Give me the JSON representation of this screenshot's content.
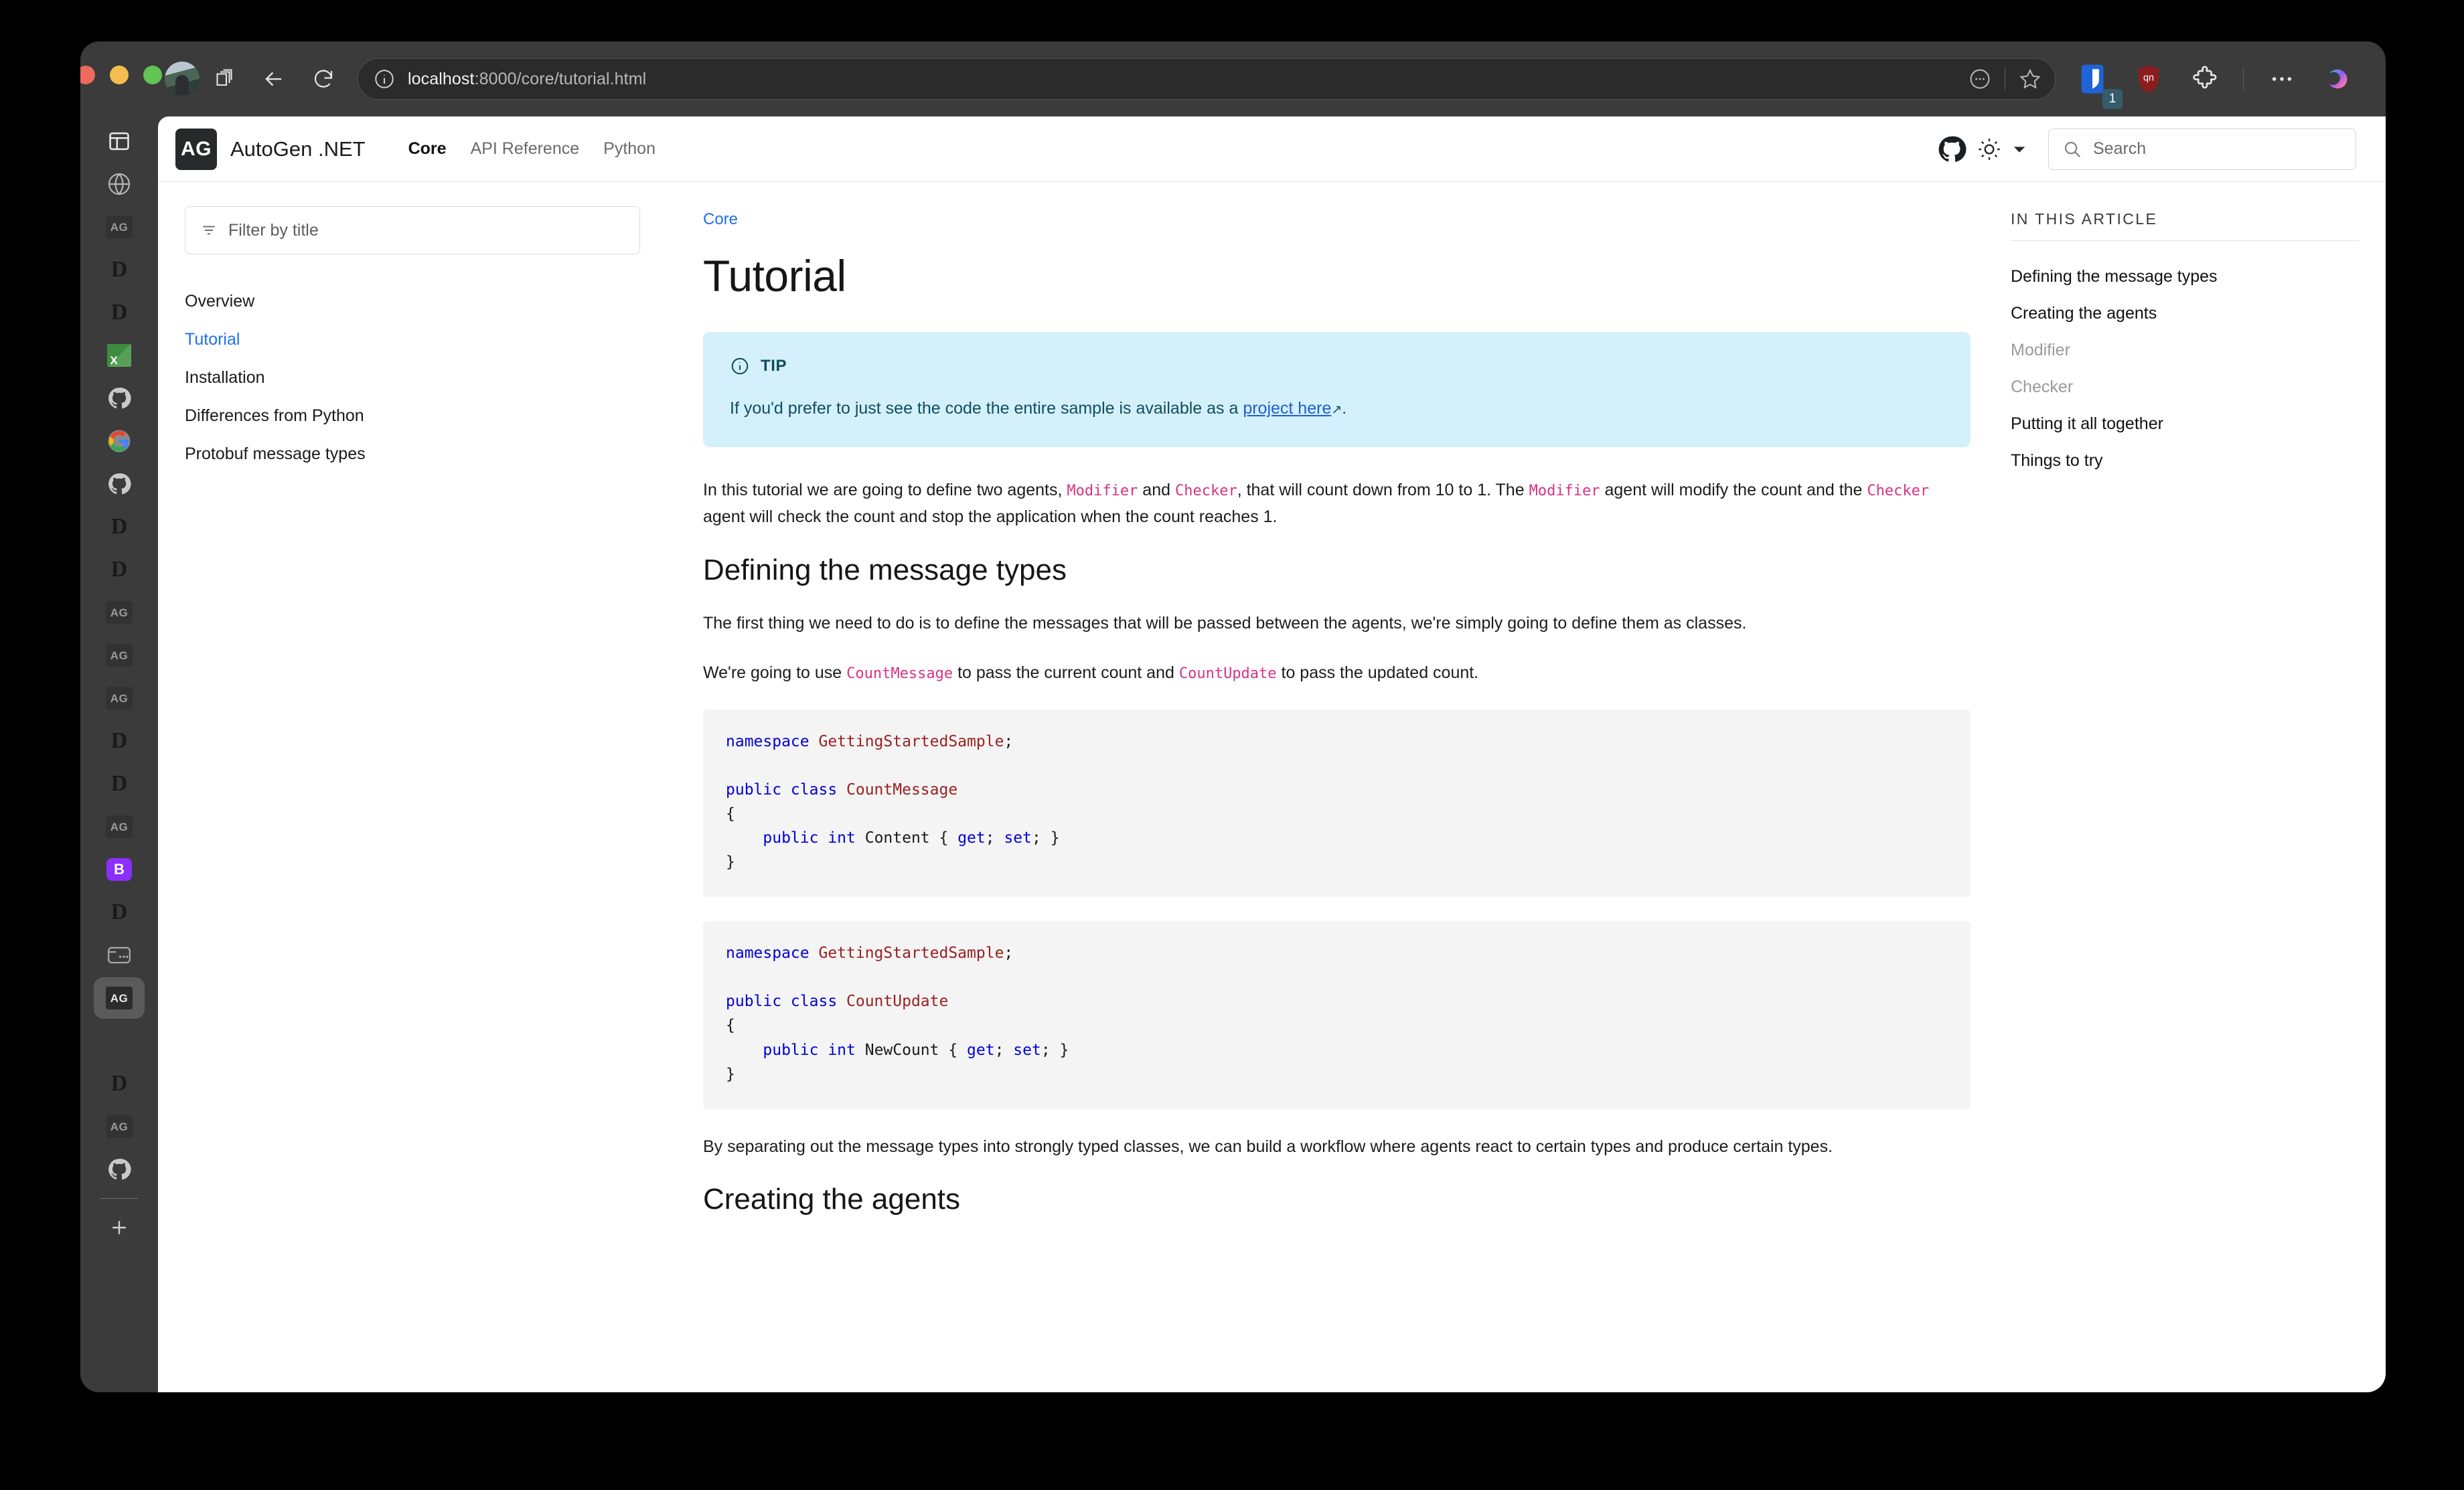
{
  "browser": {
    "url_host": "localhost",
    "url_rest": ":8000/core/tutorial.html",
    "tabs": [
      {
        "name": "sidebar-toggle",
        "kind": "panel"
      },
      {
        "name": "globe",
        "kind": "globe"
      },
      {
        "name": "autogen-1",
        "kind": "ag"
      },
      {
        "name": "docs-1",
        "kind": "d"
      },
      {
        "name": "docs-2",
        "kind": "d"
      },
      {
        "name": "excel",
        "kind": "x",
        "label": "X"
      },
      {
        "name": "github-1",
        "kind": "gh"
      },
      {
        "name": "google",
        "kind": "g"
      },
      {
        "name": "github-2",
        "kind": "gh"
      },
      {
        "name": "docs-3",
        "kind": "d"
      },
      {
        "name": "docs-4",
        "kind": "d"
      },
      {
        "name": "autogen-2",
        "kind": "ag"
      },
      {
        "name": "autogen-3",
        "kind": "ag"
      },
      {
        "name": "autogen-4",
        "kind": "ag"
      },
      {
        "name": "docs-5",
        "kind": "d"
      },
      {
        "name": "docs-6",
        "kind": "d"
      },
      {
        "name": "autogen-5",
        "kind": "ag"
      },
      {
        "name": "bing-copilot",
        "kind": "b",
        "label": "B"
      },
      {
        "name": "docs-7",
        "kind": "d"
      },
      {
        "name": "split-view",
        "kind": "card"
      },
      {
        "name": "autogen-active",
        "kind": "ag",
        "active": true
      },
      {
        "name": "microsoft",
        "kind": "ms"
      },
      {
        "name": "docs-8",
        "kind": "d"
      },
      {
        "name": "autogen-6",
        "kind": "ag"
      },
      {
        "name": "github-3",
        "kind": "gh"
      }
    ],
    "extension_badge": "1"
  },
  "site": {
    "brand_mark": "AG",
    "brand_name": "AutoGen .NET",
    "nav": [
      {
        "label": "Core",
        "active": true
      },
      {
        "label": "API Reference",
        "active": false
      },
      {
        "label": "Python",
        "active": false
      }
    ],
    "search_placeholder": "Search"
  },
  "leftnav": {
    "filter_placeholder": "Filter by title",
    "items": [
      {
        "label": "Overview",
        "active": false
      },
      {
        "label": "Tutorial",
        "active": true
      },
      {
        "label": "Installation",
        "active": false
      },
      {
        "label": "Differences from Python",
        "active": false
      },
      {
        "label": "Protobuf message types",
        "active": false
      }
    ]
  },
  "article": {
    "breadcrumb": "Core",
    "title": "Tutorial",
    "tip": {
      "label": "TIP",
      "text_before": "If you'd prefer to just see the code the entire sample is available as a ",
      "link": "project here",
      "text_after": "."
    },
    "intro": {
      "p1a": "In this tutorial we are going to define two agents, ",
      "c1": "Modifier",
      "p1b": " and ",
      "c2": "Checker",
      "p1c": ", that will count down from 10 to 1. The ",
      "c3": "Modifier",
      "p1d": " agent will modify the count and the ",
      "c4": "Checker",
      "p1e": " agent will check the count and stop the application when the count reaches 1."
    },
    "section1": {
      "heading": "Defining the message types",
      "p1": "The first thing we need to do is to define the messages that will be passed between the agents, we're simply going to define them as classes.",
      "p2a": "We're going to use ",
      "c1": "CountMessage",
      "p2b": " to pass the current count and ",
      "c2": "CountUpdate",
      "p2c": " to pass the updated count.",
      "code1": [
        {
          "kw": "namespace",
          "ty": " GettingStartedSample",
          "plain": ";"
        },
        {
          "blank": true
        },
        {
          "kw": "public class",
          "ty": " CountMessage",
          "plain": ""
        },
        {
          "plain": "{"
        },
        {
          "plain": "    ",
          "kw": "public int",
          "plain2": " Content { ",
          "kw2": "get",
          "plain3": "; ",
          "kw3": "set",
          "plain4": "; }"
        },
        {
          "plain": "}"
        }
      ],
      "code2": [
        {
          "kw": "namespace",
          "ty": " GettingStartedSample",
          "plain": ";"
        },
        {
          "blank": true
        },
        {
          "kw": "public class",
          "ty": " CountUpdate",
          "plain": ""
        },
        {
          "plain": "{"
        },
        {
          "plain": "    ",
          "kw": "public int",
          "plain2": " NewCount { ",
          "kw2": "get",
          "plain3": "; ",
          "kw3": "set",
          "plain4": "; }"
        },
        {
          "plain": "}"
        }
      ],
      "p3": "By separating out the message types into strongly typed classes, we can build a workflow where agents react to certain types and produce certain types."
    },
    "section2": {
      "heading": "Creating the agents"
    }
  },
  "rightnav": {
    "title": "IN THIS ARTICLE",
    "items": [
      {
        "label": "Defining the message types",
        "sub": false
      },
      {
        "label": "Creating the agents",
        "sub": false
      },
      {
        "label": "Modifier",
        "sub": true
      },
      {
        "label": "Checker",
        "sub": true
      },
      {
        "label": "Putting it all together",
        "sub": false
      },
      {
        "label": "Things to try",
        "sub": false
      }
    ]
  }
}
